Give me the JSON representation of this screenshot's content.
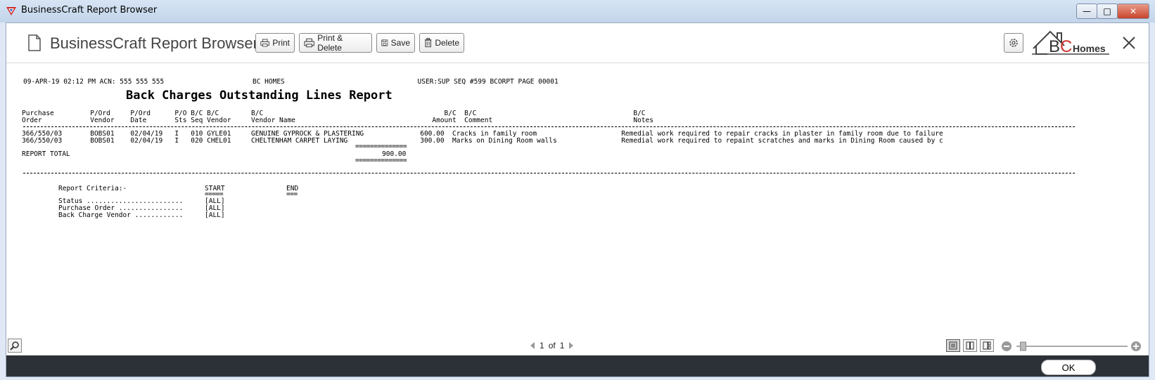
{
  "window": {
    "title": "BusinessCraft Report Browser"
  },
  "toolbar": {
    "title": "BusinessCraft Report Browser",
    "print_label": "Print",
    "print_delete_label": "Print & Delete",
    "save_label": "Save",
    "delete_label": "Delete"
  },
  "logo": {
    "text_b": "B",
    "text_c": "C",
    "text_homes": "Homes",
    "color_b": "#333333",
    "color_c": "#d0312d"
  },
  "report": {
    "header_line": "09-APR-19 02:12 PM ACN: 555 555 555                      BC HOMES                                 USER:SUP SEQ #599 BCORPT PAGE 00001",
    "title": "Back Charges Outstanding Lines Report",
    "columns_row1": "Purchase         P/Ord     P/Ord      P/O B/C B/C        B/C                                             B/C  B/C                                       B/C",
    "columns_row2": "Order            Vendor    Date       Sts Seq Vendor     Vendor Name                                  Amount  Comment                                   Notes",
    "rows": [
      "366/550/03       BOBS01    02/04/19   I   010 GYLE01     GENUINE GYPROCK & PLASTERING              600.00  Cracks in family room                     Remedial work required to repair cracks in plaster in family room due to failure",
      "366/550/03       BOBS01    02/04/19   I   020 CHEL01     CHELTENHAM CARPET LAYING                  300.00  Marks on Dining Room walls                Remedial work required to repaint scratches and marks in Dining Room caused by c"
    ],
    "total_label": "REPORT TOTAL",
    "total_value": "900.00",
    "eq_line": "==============",
    "criteria": {
      "title": "Report Criteria:-",
      "start_label": "START",
      "end_label": "END",
      "start_underline": "=====",
      "end_underline": "===",
      "items": [
        {
          "label": "Status ........................",
          "value": "[ALL]"
        },
        {
          "label": "Purchase Order ................",
          "value": "[ALL]"
        },
        {
          "label": "Back Charge Vendor ............",
          "value": "[ALL]"
        }
      ]
    }
  },
  "pager": {
    "current": "1",
    "of": "of",
    "total": "1"
  },
  "zoom": {
    "level": 0.06
  },
  "footer": {
    "ok_label": "OK"
  },
  "colors": {
    "footer_bg": "#2c3137",
    "titlebar": "#c3d5ea"
  }
}
